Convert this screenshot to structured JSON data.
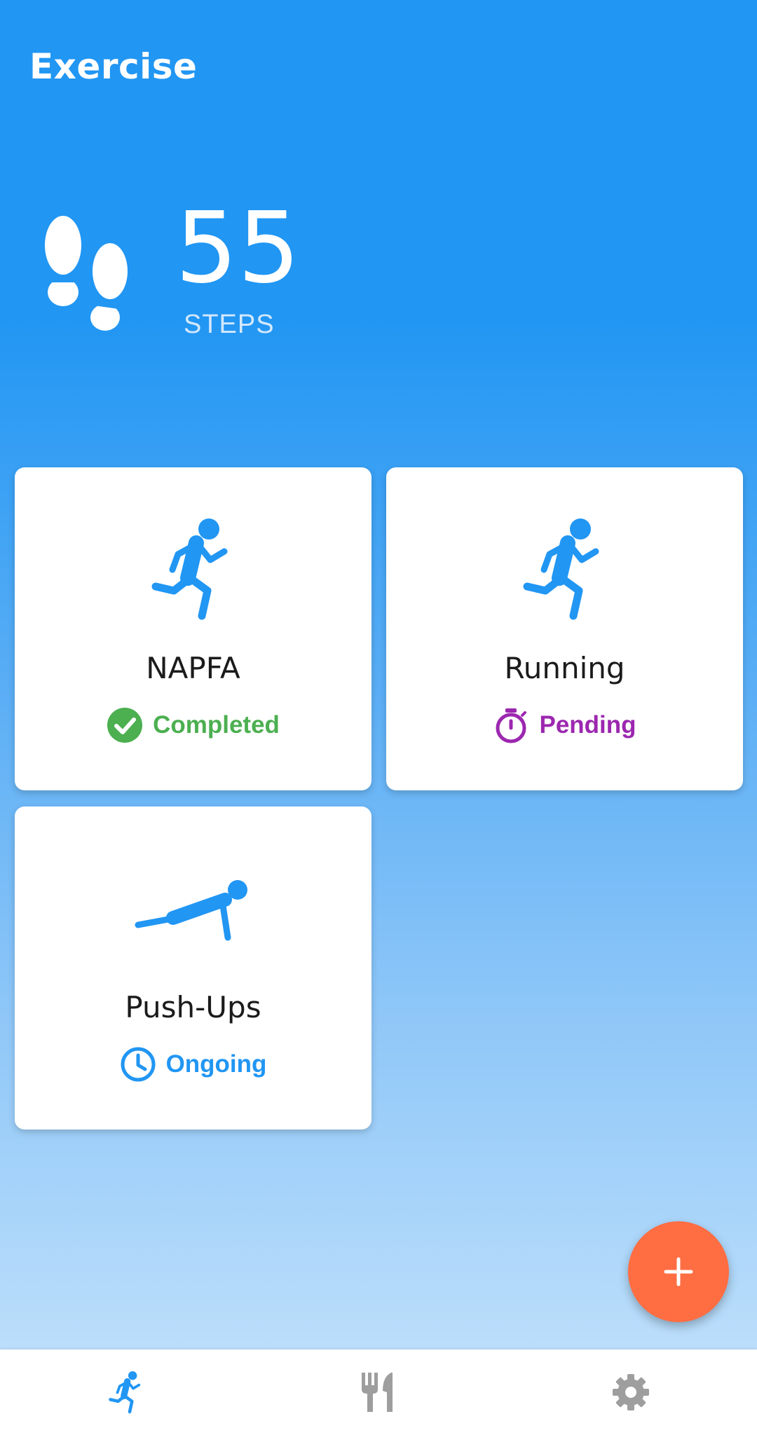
{
  "header": {
    "title": "Exercise"
  },
  "steps": {
    "count": "55",
    "label": "STEPS",
    "icon": "footprints-icon"
  },
  "cards": [
    {
      "name": "NAPFA",
      "icon": "running-person-icon",
      "status": "Completed",
      "status_icon": "check-circle-icon",
      "status_color": "#4CAF50"
    },
    {
      "name": "Running",
      "icon": "running-person-icon",
      "status": "Pending",
      "status_icon": "stopwatch-icon",
      "status_color": "#9C27B0"
    },
    {
      "name": "Push-Ups",
      "icon": "push-up-icon",
      "status": "Ongoing",
      "status_icon": "clock-icon",
      "status_color": "#2196F3"
    }
  ],
  "fab": {
    "icon": "plus-icon",
    "color": "#FF6D42"
  },
  "bottom_nav": [
    {
      "icon": "running-person-icon",
      "active": true,
      "color": "#2196F3"
    },
    {
      "icon": "fork-knife-icon",
      "active": false,
      "color": "#9E9E9E"
    },
    {
      "icon": "gear-icon",
      "active": false,
      "color": "#9E9E9E"
    }
  ],
  "colors": {
    "primary": "#2196F3",
    "accent": "#FF6D42"
  }
}
